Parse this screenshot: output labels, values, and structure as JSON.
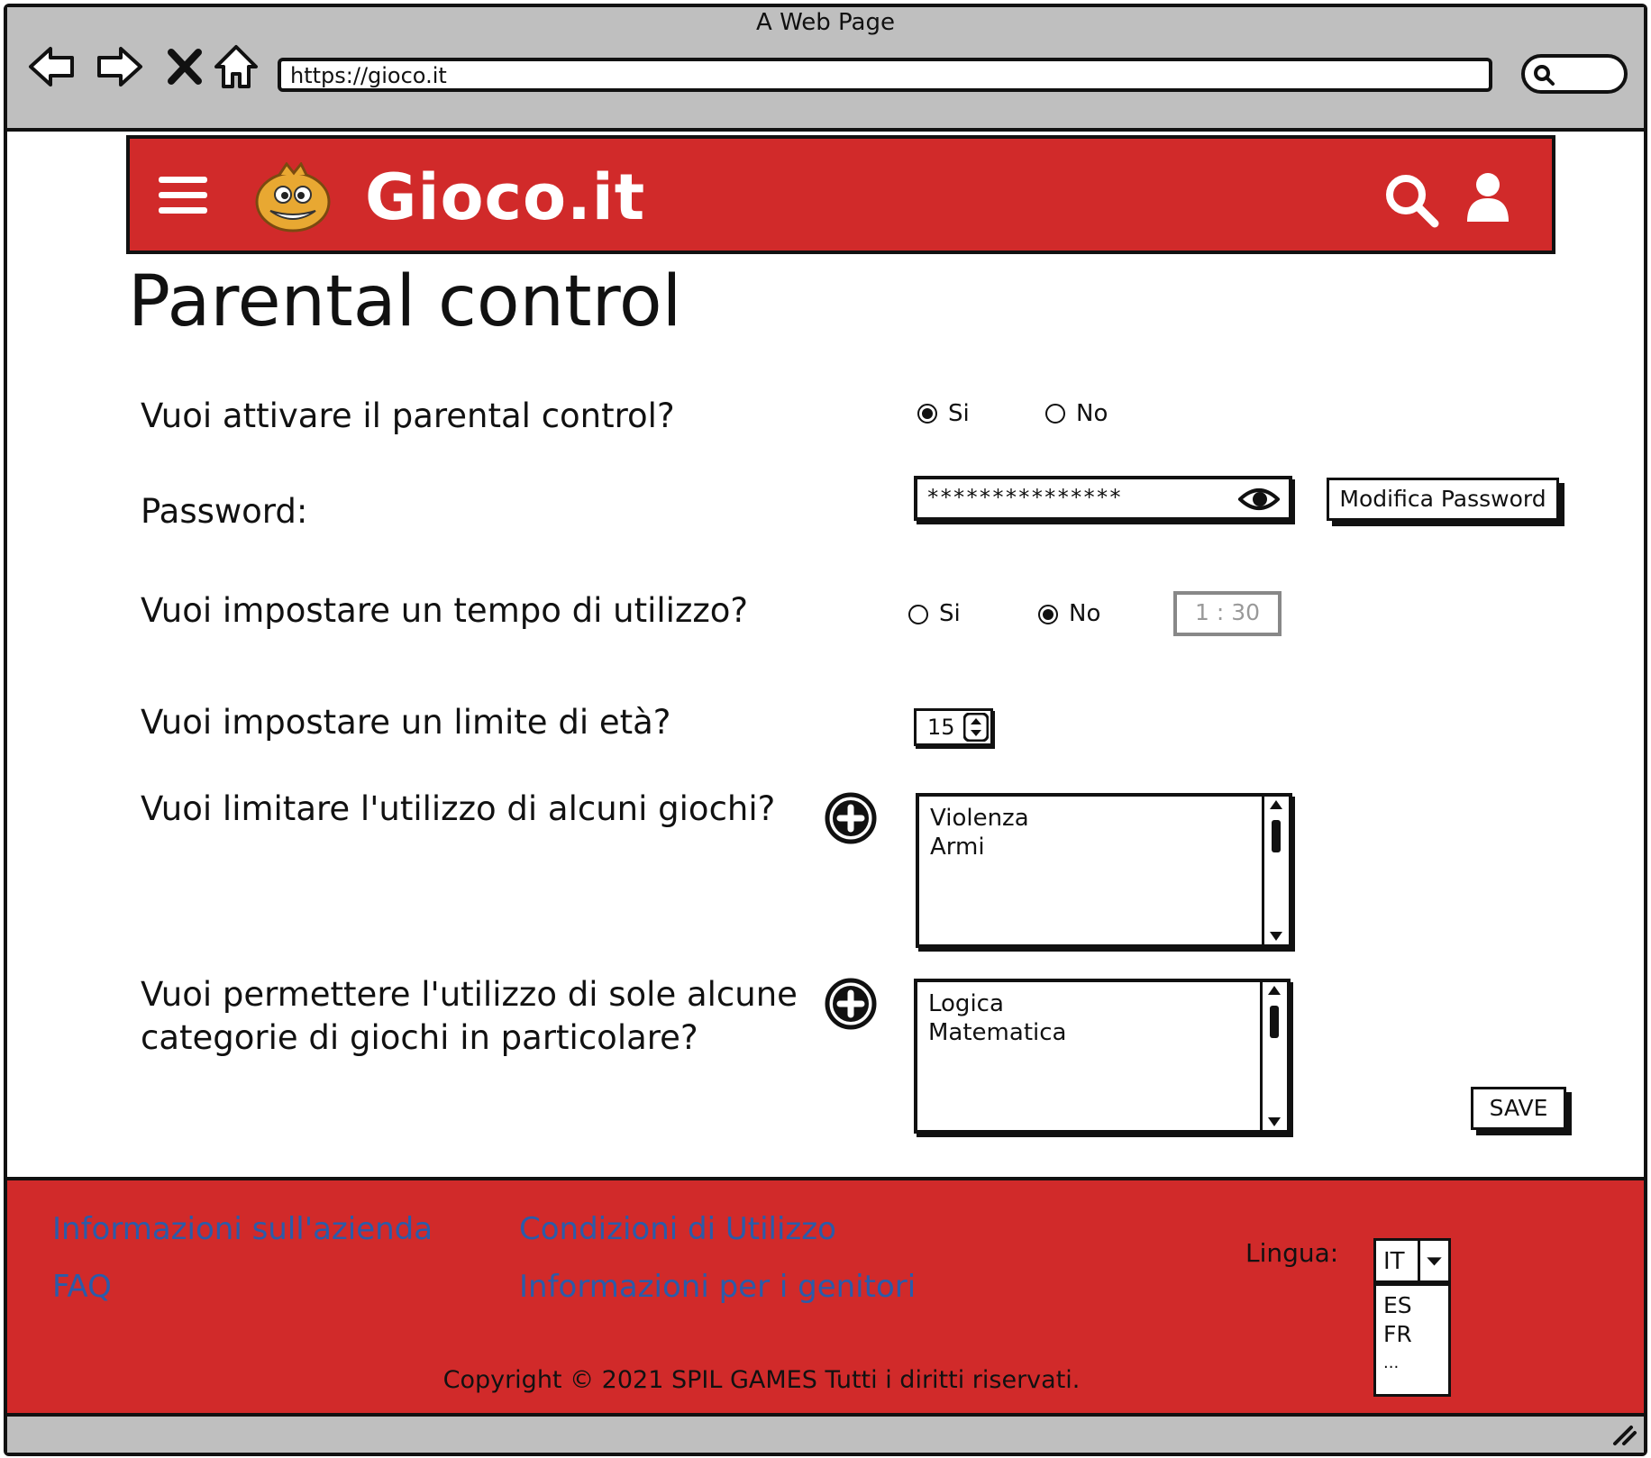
{
  "browser": {
    "window_title": "A Web Page",
    "url": "https://gioco.it"
  },
  "header": {
    "logo_text": "Gioco.it",
    "icons": [
      "menu-icon",
      "mascot-logo",
      "search-icon",
      "user-icon"
    ]
  },
  "page_title": "Parental control",
  "form": {
    "activate_question": "Vuoi attivare il parental control?",
    "activate_yes": "Si",
    "activate_no": "No",
    "activate_selected": "Si",
    "password_label": "Password:",
    "password_value": "***************",
    "modify_password_button": "Modifica Password",
    "time_question": "Vuoi impostare un tempo di utilizzo?",
    "time_yes": "Si",
    "time_no": "No",
    "time_selected": "No",
    "time_value": "1 :  30",
    "age_question": "Vuoi impostare un limite di età?",
    "age_value": "15",
    "limit_games_question": "Vuoi limitare l'utilizzo di alcuni giochi?",
    "limit_games_items": [
      "Violenza",
      "Armi"
    ],
    "categories_question_line1": "Vuoi permettere l'utilizzo di sole alcune",
    "categories_question_line2": "categorie di giochi in particolare?",
    "categories_items": [
      "Logica",
      "Matematica"
    ],
    "save_button": "SAVE"
  },
  "footer": {
    "links": [
      "Informazioni sull'azienda",
      "FAQ",
      "Condizioni di Utilizzo",
      "Informazioni per i genitori"
    ],
    "language_label": "Lingua:",
    "language_selected": "IT",
    "language_options": [
      "ES",
      "FR",
      "..."
    ],
    "copyright": "Copyright © 2021 SPIL GAMES Tutti i diritti riservati.",
    "link_color": "#2a5caa",
    "background_color": "#d12a2a"
  }
}
